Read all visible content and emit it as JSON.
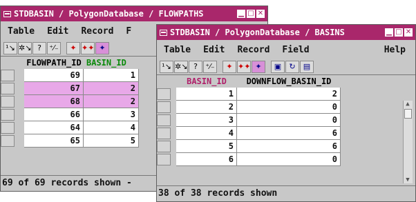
{
  "colors": {
    "titlebar": "#a9276b",
    "highlight_row": "#e8a8e8",
    "basin_id_header_w1": "#0a8a0a",
    "basin_id_header_w2": "#b0206a"
  },
  "window1": {
    "title": "STDBASIN / PolygonDatabase / FLOWPATHS",
    "menu": [
      "Table",
      "Edit",
      "Record",
      "F"
    ],
    "columns": [
      "FLOWPATH_ID",
      "BASIN_ID"
    ],
    "rows": [
      {
        "c1": "69",
        "c2": "1",
        "hl": false
      },
      {
        "c1": "67",
        "c2": "2",
        "hl": true
      },
      {
        "c1": "68",
        "c2": "2",
        "hl": true
      },
      {
        "c1": "66",
        "c2": "3",
        "hl": false
      },
      {
        "c1": "64",
        "c2": "4",
        "hl": false
      },
      {
        "c1": "65",
        "c2": "5",
        "hl": false
      }
    ],
    "status": "69 of 69 records shown -"
  },
  "window2": {
    "title": "STDBASIN / PolygonDatabase / BASINS",
    "menu": [
      "Table",
      "Edit",
      "Record",
      "Field"
    ],
    "help": "Help",
    "columns": [
      "BASIN_ID",
      "DOWNFLOW_BASIN_ID"
    ],
    "rows": [
      {
        "c1": "1",
        "c2": "2"
      },
      {
        "c1": "2",
        "c2": "0"
      },
      {
        "c1": "3",
        "c2": "0"
      },
      {
        "c1": "4",
        "c2": "6"
      },
      {
        "c1": "5",
        "c2": "6"
      },
      {
        "c1": "6",
        "c2": "0"
      }
    ],
    "status": "38 of 38 records shown"
  },
  "toolbar_icons": [
    "row-single-icon",
    "row-multi-icon",
    "query-icon",
    "sort-icon",
    "insert-record-icon",
    "insert-multi-record-icon",
    "select-records-icon",
    "save-icon",
    "refresh-icon",
    "export-icon"
  ]
}
